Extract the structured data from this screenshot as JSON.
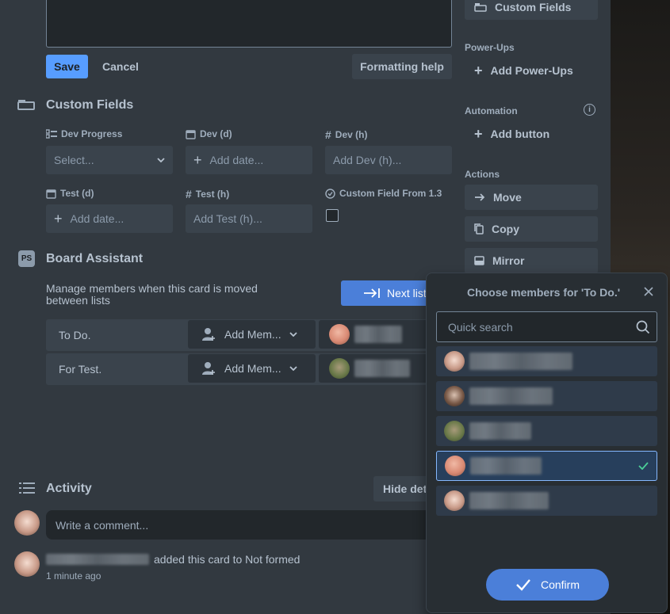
{
  "editor": {
    "save_label": "Save",
    "cancel_label": "Cancel",
    "formatting_label": "Formatting help"
  },
  "custom_fields": {
    "title": "Custom Fields",
    "fields": {
      "dev_progress": {
        "label": "Dev Progress",
        "value": "Select..."
      },
      "dev_d": {
        "label": "Dev (d)",
        "placeholder": "Add date..."
      },
      "dev_h": {
        "label": "Dev (h)",
        "placeholder": "Add Dev (h)..."
      },
      "test_d": {
        "label": "Test (d)",
        "placeholder": "Add date..."
      },
      "test_h": {
        "label": "Test (h)",
        "placeholder": "Add Test (h)..."
      },
      "cf13": {
        "label": "Custom Field From 1.3",
        "checked": false
      }
    }
  },
  "board_assistant": {
    "badge": "PS",
    "title": "Board Assistant",
    "description": "Manage members when this card is moved between lists",
    "next_list_label": "Next list",
    "rows": [
      {
        "list": "To Do.",
        "add_label": "Add Mem..."
      },
      {
        "list": "For Test.",
        "add_label": "Add Mem..."
      }
    ]
  },
  "activity": {
    "title": "Activity",
    "hide_details_label": "Hide details",
    "comment_placeholder": "Write a comment...",
    "entry_text": "added this card to Not formed",
    "entry_time": "1 minute ago"
  },
  "sidebar": {
    "custom_fields_label": "Custom Fields",
    "powerups_heading": "Power-Ups",
    "add_powerups_label": "Add Power-Ups",
    "automation_heading": "Automation",
    "add_button_label": "Add button",
    "actions_heading": "Actions",
    "move_label": "Move",
    "copy_label": "Copy",
    "mirror_label": "Mirror"
  },
  "popup": {
    "title": "Choose members for 'To Do.'",
    "search_placeholder": "Quick search",
    "confirm_label": "Confirm",
    "members": [
      {
        "avatar": "pale",
        "selected": false
      },
      {
        "avatar": "dark",
        "selected": false
      },
      {
        "avatar": "green",
        "selected": false
      },
      {
        "avatar": "pink",
        "selected": true
      },
      {
        "avatar": "pale",
        "selected": false
      }
    ]
  },
  "colors": {
    "primary": "#579dff",
    "confirm": "#4b7fd9",
    "checkmark": "#4bce97"
  }
}
